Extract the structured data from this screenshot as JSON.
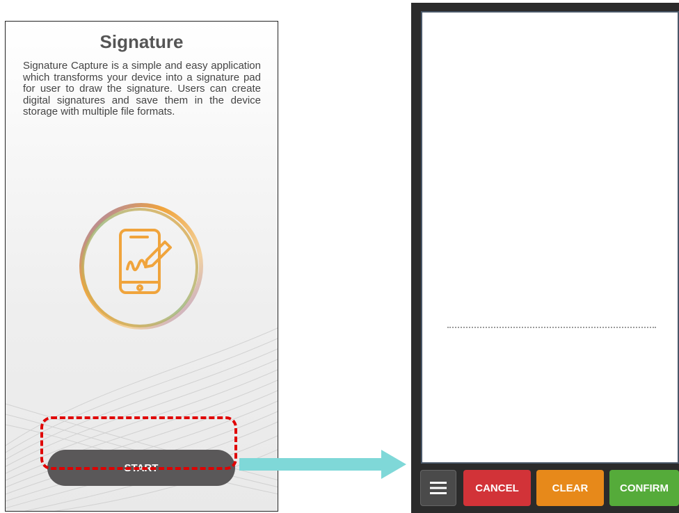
{
  "left_screen": {
    "title": "Signature",
    "description": "Signature  Capture is a simple and easy application which transforms your device into a signature  pad  for user to draw the signature. Users can create digital signatures and save them in the device storage with multiple file formats.",
    "start_label": "START",
    "logo_icon": "signature-phone-icon",
    "highlight_color": "#e00000"
  },
  "right_screen": {
    "menu_icon": "hamburger-menu-icon",
    "cancel_label": "CANCEL",
    "clear_label": "CLEAR",
    "confirm_label": "CONFIRM",
    "colors": {
      "cancel": "#d23338",
      "clear": "#e7891a",
      "confirm": "#55ab3a",
      "frame": "#2b2b2b"
    }
  },
  "arrow": {
    "color": "#7fd8d8"
  }
}
